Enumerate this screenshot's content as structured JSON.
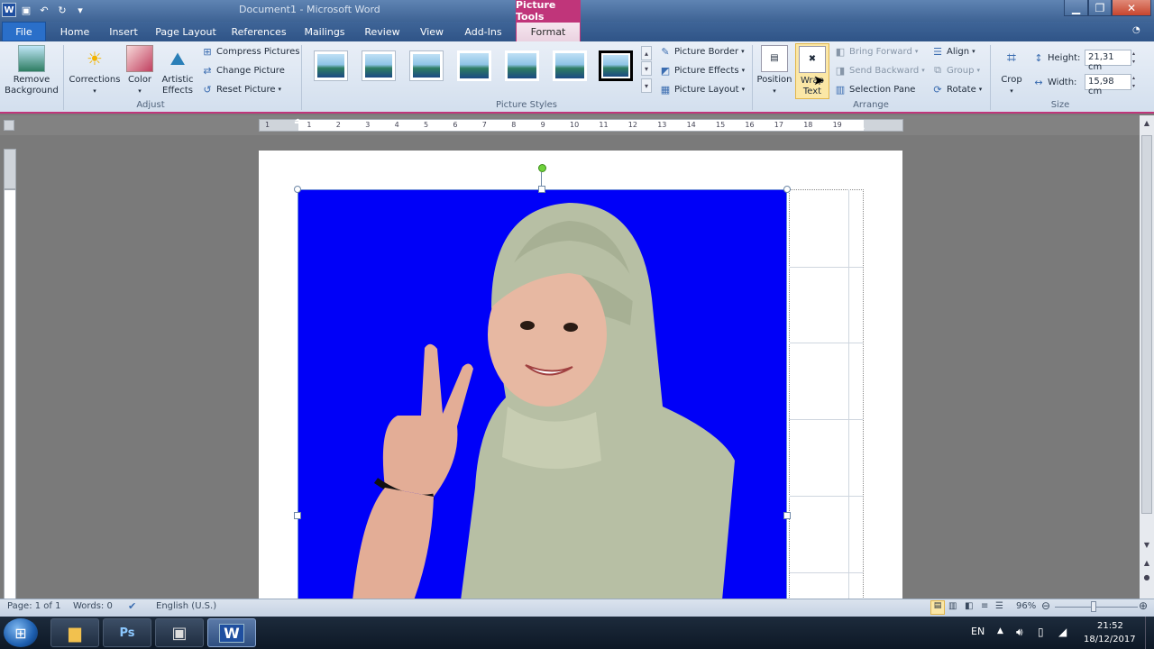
{
  "window": {
    "title": "Document1 - Microsoft Word",
    "context_header": "Picture Tools"
  },
  "qat": {
    "icons": [
      "word-icon",
      "save-icon",
      "undo-icon",
      "redo-icon",
      "customize-icon"
    ]
  },
  "tabs": {
    "file": "File",
    "home": "Home",
    "insert": "Insert",
    "page_layout": "Page Layout",
    "references": "References",
    "mailings": "Mailings",
    "review": "Review",
    "view": "View",
    "addins": "Add-Ins",
    "format": "Format"
  },
  "ribbon": {
    "adjust": {
      "label": "Adjust",
      "remove_bg_1": "Remove",
      "remove_bg_2": "Background",
      "corrections": "Corrections",
      "color": "Color",
      "artistic_1": "Artistic",
      "artistic_2": "Effects",
      "compress": "Compress Pictures",
      "change": "Change Picture",
      "reset": "Reset Picture"
    },
    "styles": {
      "label": "Picture Styles",
      "border": "Picture Border",
      "effects": "Picture Effects",
      "layout": "Picture Layout"
    },
    "arrange": {
      "label": "Arrange",
      "position": "Position",
      "wrap_1": "Wrap",
      "wrap_2": "Text",
      "bring_forward": "Bring Forward",
      "send_backward": "Send Backward",
      "selection_pane": "Selection Pane",
      "align": "Align",
      "group": "Group",
      "rotate": "Rotate"
    },
    "size": {
      "label": "Size",
      "crop": "Crop",
      "height_label": "Height:",
      "height_value": "21,31 cm",
      "width_label": "Width:",
      "width_value": "15,98 cm"
    }
  },
  "ruler_numbers": [
    "1",
    "1",
    "2",
    "3",
    "4",
    "5",
    "6",
    "7",
    "8",
    "9",
    "10",
    "11",
    "12",
    "13",
    "14",
    "15",
    "16",
    "17",
    "18",
    "19"
  ],
  "status": {
    "page": "Page: 1 of 1",
    "words": "Words: 0",
    "language": "English (U.S.)",
    "zoom": "96%"
  },
  "taskbar": {
    "lang": "EN",
    "time": "21:52",
    "date": "18/12/2017",
    "apps": [
      "explorer-icon",
      "photoshop-icon",
      "media-icon",
      "word-icon"
    ],
    "ps_label": "Ps",
    "word_label": "W"
  }
}
